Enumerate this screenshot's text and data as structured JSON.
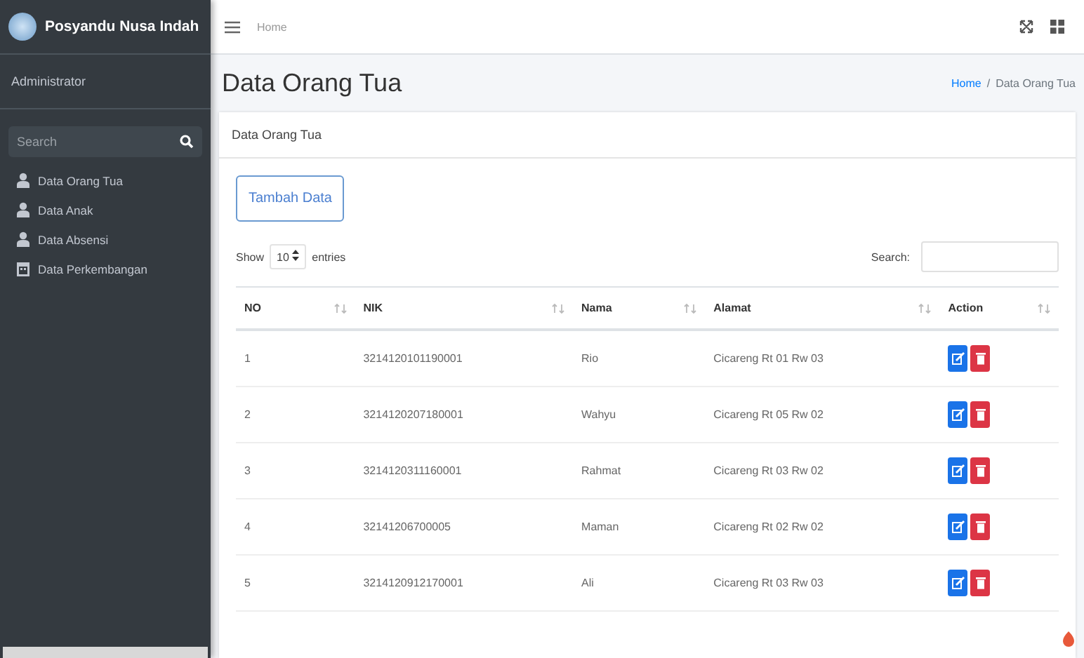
{
  "brand": {
    "name": "Posyandu Nusa Indah"
  },
  "sidebar": {
    "user": "Administrator",
    "search": {
      "placeholder": "Search"
    },
    "items": [
      {
        "label": "Data Orang Tua",
        "kind": "person"
      },
      {
        "label": "Data Anak",
        "kind": "person"
      },
      {
        "label": "Data Absensi",
        "kind": "person"
      },
      {
        "label": "Data Perkembangan",
        "kind": "calendar"
      }
    ]
  },
  "topbar": {
    "link": "Home"
  },
  "page": {
    "title": "Data Orang Tua",
    "breadcrumb": {
      "home": "Home",
      "separator": "/",
      "current": "Data Orang Tua"
    }
  },
  "card": {
    "title": "Data Orang Tua",
    "add_button": "Tambah Data",
    "show_label": "Show",
    "entries": "10",
    "entries_label": "entries",
    "search_label": "Search:"
  },
  "table": {
    "columns": [
      "NO",
      "NIK",
      "Nama",
      "Alamat",
      "Action"
    ],
    "rows": [
      [
        "1",
        "3214120101190001",
        "Rio",
        "Cicareng Rt 01 Rw 03"
      ],
      [
        "2",
        "3214120207180001",
        "Wahyu",
        "Cicareng Rt 05 Rw 02"
      ],
      [
        "3",
        "3214120311160001",
        "Rahmat",
        "Cicareng Rt 03 Rw 02"
      ],
      [
        "4",
        "32141206700005",
        "Maman",
        "Cicareng Rt 02 Rw 02"
      ],
      [
        "5",
        "3214120912170001",
        "Ali",
        "Cicareng Rt 03 Rw 03"
      ]
    ]
  }
}
